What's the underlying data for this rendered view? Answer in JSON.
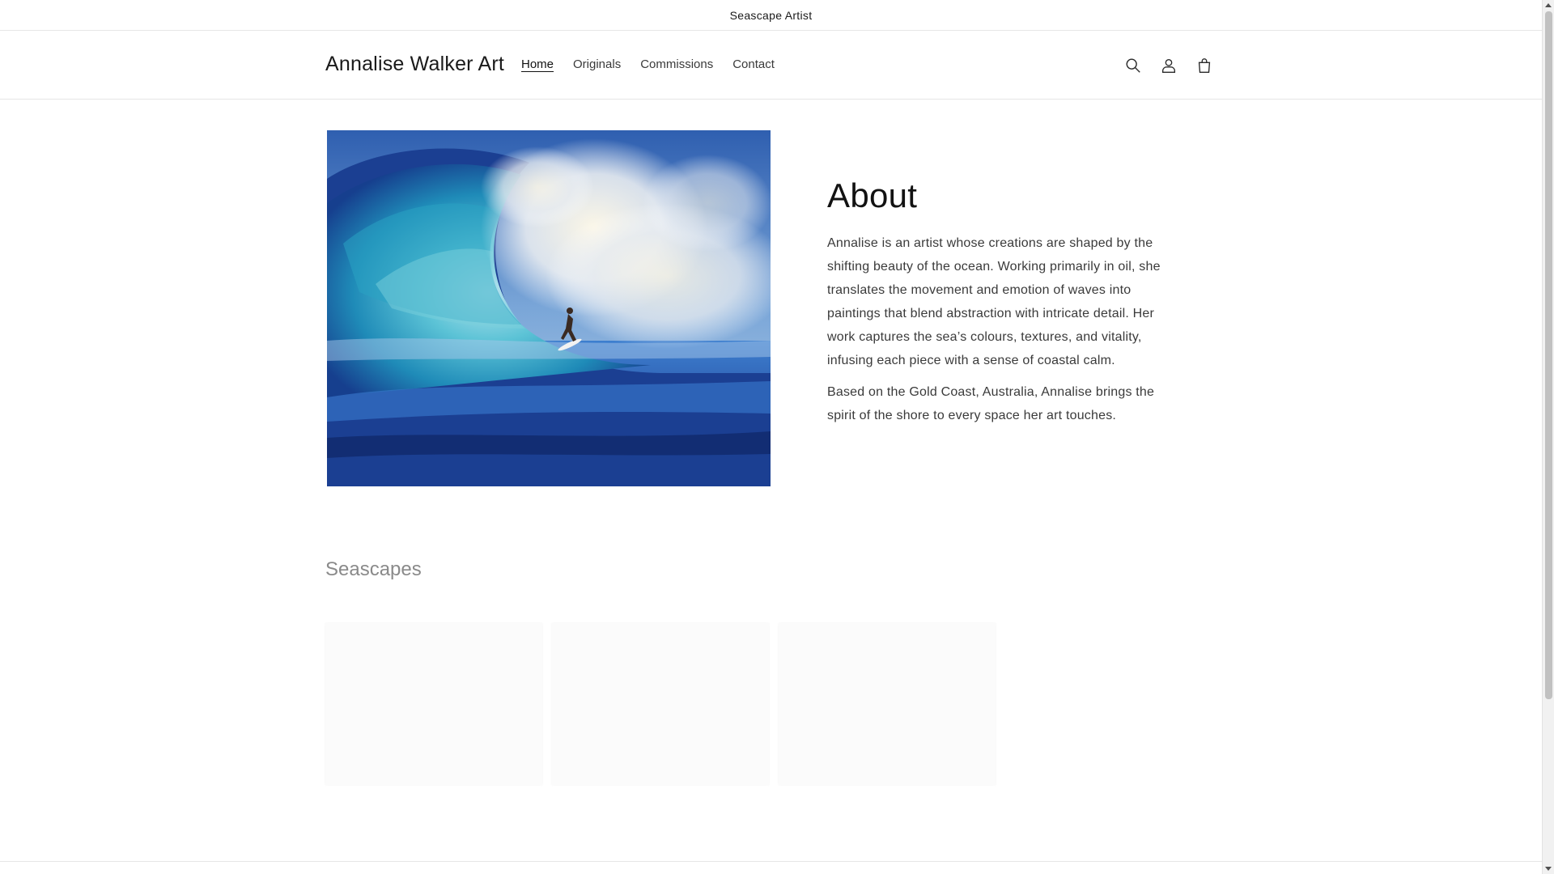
{
  "announcement": {
    "text": "Seascape Artist"
  },
  "header": {
    "logo": "Annalise Walker Art",
    "nav": [
      {
        "label": "Home",
        "active": true
      },
      {
        "label": "Originals",
        "active": false
      },
      {
        "label": "Commissions",
        "active": false
      },
      {
        "label": "Contact",
        "active": false
      }
    ],
    "icons": [
      "search-icon",
      "account-icon",
      "cart-icon"
    ]
  },
  "about": {
    "heading": "About",
    "paragraphs": [
      "Annalise is an artist whose creations are shaped by the shifting beauty of the ocean. Working primarily in oil, she translates the movement and emotion of waves into paintings that blend abstraction with intricate detail. Her work captures the sea’s colours, textures, and vitality, infusing each piece with a sense of coastal calm.",
      "Based on the Gold Coast, Australia, Annalise brings the spirit of the shore to every space her art touches."
    ]
  },
  "seascapes": {
    "title": "Seascapes"
  },
  "colors": {
    "wave_dark": "#1d3e8f",
    "wave_mid": "#2e7fc4",
    "wave_teal": "#3fb0c8",
    "foam": "#f1ecd9",
    "sky": "#6e9cd3"
  }
}
